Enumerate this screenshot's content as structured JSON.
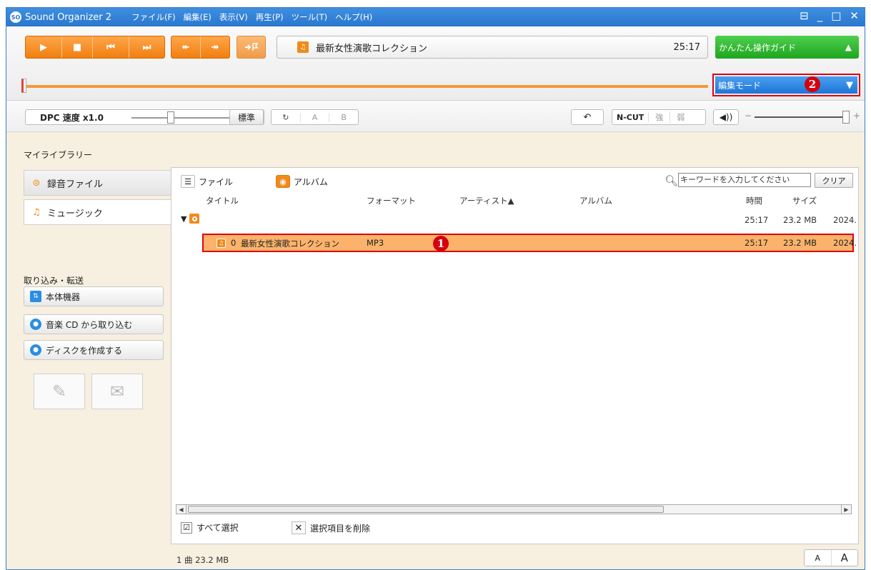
{
  "titlebar": {
    "logo": "SO",
    "app_title": "Sound Organizer 2",
    "menus": [
      "ファイル(F)",
      "編集(E)",
      "表示(V)",
      "再生(P)",
      "ツール(T)",
      "ヘルプ(H)"
    ],
    "controls": [
      "⊟",
      "_",
      "□",
      "✕"
    ]
  },
  "toolbar": {
    "transport": [
      "▶",
      "■",
      "⏮",
      "⏭"
    ],
    "jump": [
      "↞",
      "↠"
    ],
    "track_title": "最新女性演歌コレクション",
    "track_time": "25:17",
    "guide_label": "かんたん操作ガイド",
    "mode_label": "編集モード",
    "seek_position": 0.0
  },
  "markers": [
    "1",
    "2"
  ],
  "dpc": {
    "label": "DPC 速度 x1.0",
    "std_label": "標準",
    "a_label": "A",
    "b_label": "B",
    "ncut_label": "N-CUT",
    "strong_label": "強",
    "weak_label": "弱",
    "volume_level": 1.0
  },
  "sidebar": {
    "library_heading": "マイライブラリー",
    "tabs": [
      {
        "label": "録音ファイル",
        "icon": "speech-bubble-icon"
      },
      {
        "label": "ミュージック",
        "icon": "music-note-icon"
      }
    ],
    "transfer_heading": "取り込み・転送",
    "buttons": [
      {
        "label": "本体機器",
        "icon": "device-transfer-icon"
      },
      {
        "label": "音楽 CD から取り込む",
        "icon": "cd-import-icon"
      },
      {
        "label": "ディスクを作成する",
        "icon": "disc-create-icon"
      }
    ]
  },
  "main": {
    "view_file_label": "ファイル",
    "view_album_label": "アルバム",
    "search_placeholder": "キーワードを入力してください",
    "clear_label": "クリア",
    "columns": {
      "title": "タイトル",
      "format": "フォーマット",
      "artist": "アーティスト▲",
      "album": "アルバム",
      "time": "時間",
      "size": "サイズ"
    },
    "group": {
      "time": "25:17",
      "size": "23.2 MB",
      "date": "2024."
    },
    "row": {
      "track_no": "0",
      "title": "最新女性演歌コレクション",
      "format": "MP3",
      "time": "25:17",
      "size": "23.2 MB",
      "date": "2024."
    },
    "select_all_label": "すべて選択",
    "delete_label": "選択項目を削除"
  },
  "status": {
    "summary": "1 曲 23.2 MB",
    "font_small": "A",
    "font_large": "A"
  }
}
